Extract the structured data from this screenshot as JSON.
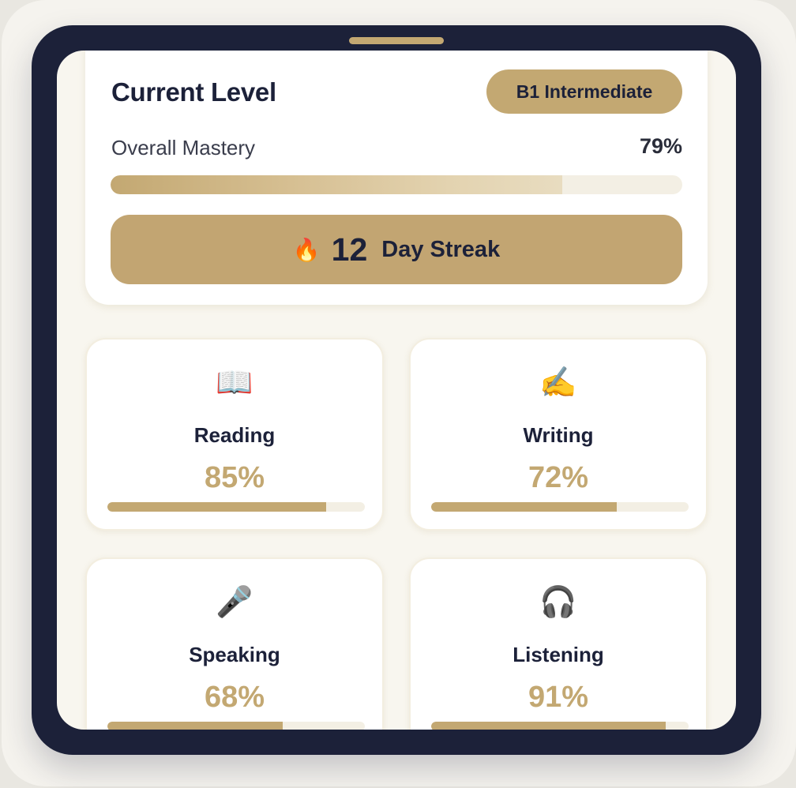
{
  "level": {
    "title": "Current Level",
    "badge": "B1 Intermediate",
    "mastery_label": "Overall Mastery",
    "mastery_value": "79%",
    "mastery_fraction": 0.79
  },
  "streak": {
    "icon": "fire-icon",
    "glyph": "🔥",
    "count": "12",
    "label": "Day Streak"
  },
  "skills": [
    {
      "name": "Reading",
      "percent": "85%",
      "fraction": 0.85,
      "icon": "open-book-icon",
      "glyph": "📖"
    },
    {
      "name": "Writing",
      "percent": "72%",
      "fraction": 0.72,
      "icon": "writing-hand-icon",
      "glyph": "✍️"
    },
    {
      "name": "Speaking",
      "percent": "68%",
      "fraction": 0.68,
      "icon": "microphone-icon",
      "glyph": "🎤"
    },
    {
      "name": "Listening",
      "percent": "91%",
      "fraction": 0.91,
      "icon": "headphones-icon",
      "glyph": "🎧"
    }
  ],
  "colors": {
    "gold": "#c3a872",
    "navy": "#1c2139",
    "track": "#f3efe4"
  }
}
